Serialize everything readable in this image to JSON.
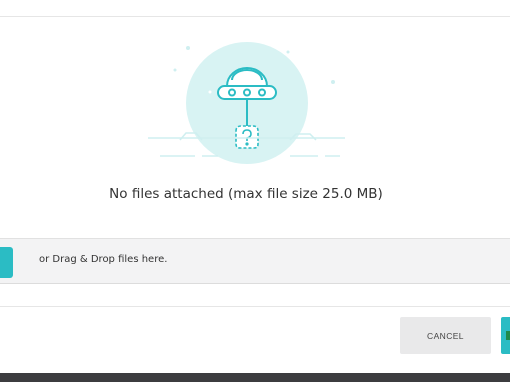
{
  "upload": {
    "empty_message": "No files attached (max file size 25.0 MB)",
    "drop_hint": "or Drag & Drop files here."
  },
  "footer": {
    "cancel_label": "CANCEL"
  },
  "colors": {
    "accent": "#2bbcc4",
    "illustration_bg": "#d8f3f3",
    "line": "#2bbcc4"
  },
  "icons": {
    "illustration": "ufo-with-unknown-file-illustration",
    "primary_button_mark": "green-square"
  }
}
